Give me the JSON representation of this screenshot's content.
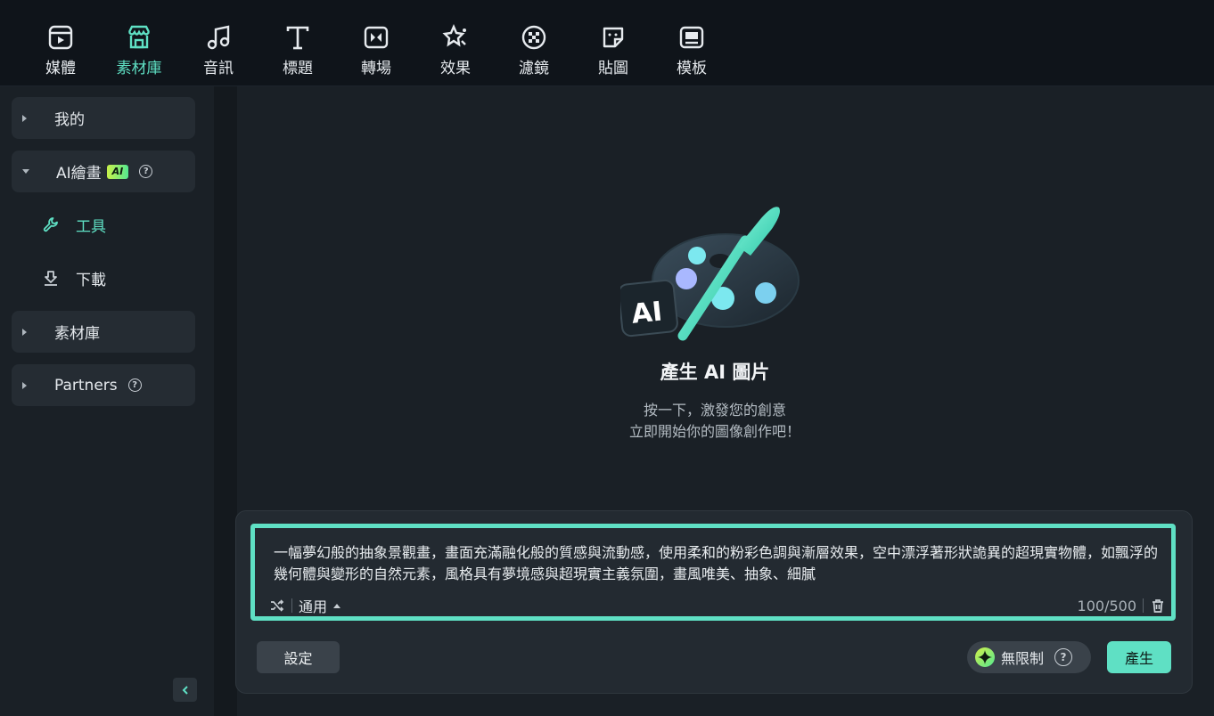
{
  "toolbar": {
    "items": [
      {
        "label": "媒體",
        "icon": "media-icon"
      },
      {
        "label": "素材庫",
        "icon": "store-icon",
        "active": true
      },
      {
        "label": "音訊",
        "icon": "music-note-icon"
      },
      {
        "label": "標題",
        "icon": "title-t-icon"
      },
      {
        "label": "轉場",
        "icon": "transition-icon"
      },
      {
        "label": "效果",
        "icon": "effects-icon"
      },
      {
        "label": "濾鏡",
        "icon": "filter-icon"
      },
      {
        "label": "貼圖",
        "icon": "sticker-icon"
      },
      {
        "label": "模板",
        "icon": "template-icon"
      }
    ],
    "accent": "#5fe0c4"
  },
  "sidebar": {
    "mine": "我的",
    "ai_drawing": "AI繪畫",
    "ai_badge": "AI",
    "help_glyph": "?",
    "tools": "工具",
    "downloads": "下載",
    "library": "素材庫",
    "partners": "Partners"
  },
  "main": {
    "illustration_badge": "AI",
    "title": "產生 AI 圖片",
    "subtitle_line1": "按一下，激發您的創意",
    "subtitle_line2": "立即開始你的圖像創作吧！"
  },
  "prompt": {
    "text": "一幅夢幻般的抽象景觀畫，畫面充滿融化般的質感與流動感，使用柔和的粉彩色調與漸層效果，空中漂浮著形狀詭異的超現實物體，如飄浮的幾何體與變形的自然元素，風格具有夢境感與超現實主義氛圍，畫風唯美、抽象、細膩",
    "style": "通用",
    "count": "100/500"
  },
  "actions": {
    "settings": "設定",
    "unlimited": "無限制",
    "generate": "產生"
  }
}
